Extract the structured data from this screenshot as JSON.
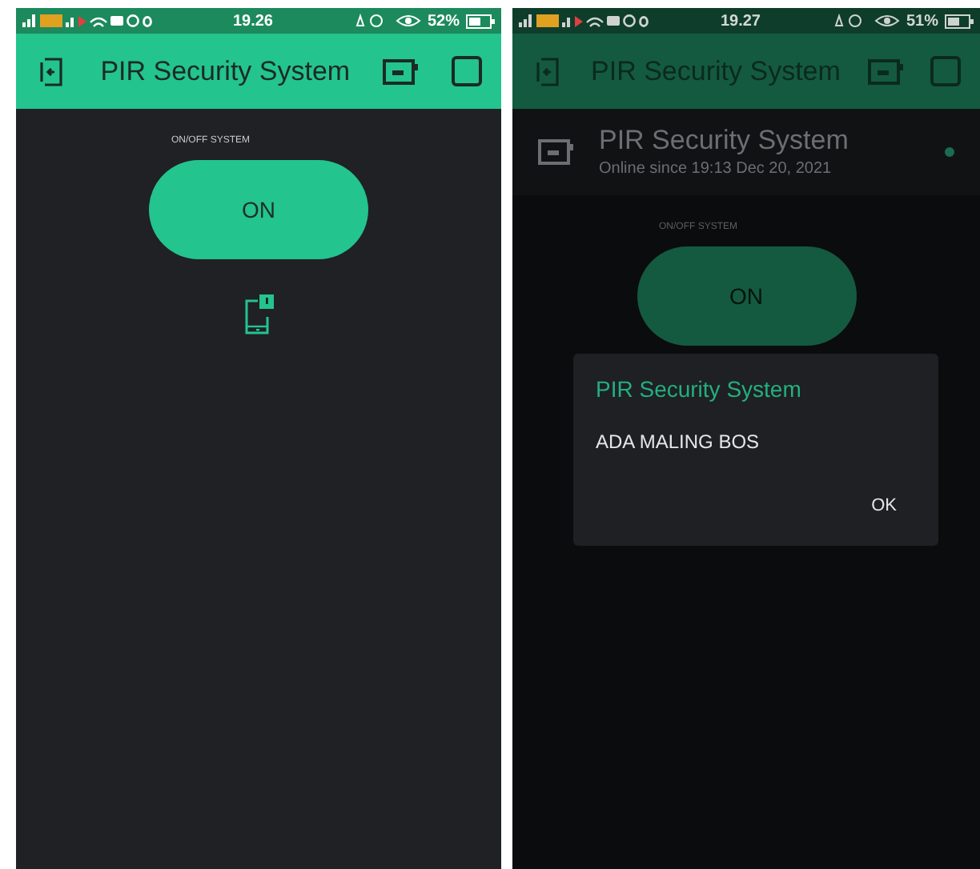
{
  "screens": [
    {
      "dimmed": false,
      "status_bar": {
        "time": "19.26",
        "battery": "52%"
      },
      "app_bar": {
        "title": "PIR Security System"
      },
      "widget_label": "ON/OFF SYSTEM",
      "switch_button": {
        "label": "ON",
        "on": true
      }
    },
    {
      "dimmed": true,
      "status_bar": {
        "time": "19.27",
        "battery": "51%"
      },
      "app_bar": {
        "title": "PIR Security System"
      },
      "device_panel": {
        "name": "PIR Security System",
        "status": "Online since 19:13 Dec 20, 2021",
        "online": true
      },
      "widget_label": "ON/OFF SYSTEM",
      "switch_button": {
        "label": "ON",
        "on": true
      },
      "dialog": {
        "title": "PIR Security System",
        "message": "ADA MALING BOS",
        "button": "OK"
      }
    }
  ]
}
